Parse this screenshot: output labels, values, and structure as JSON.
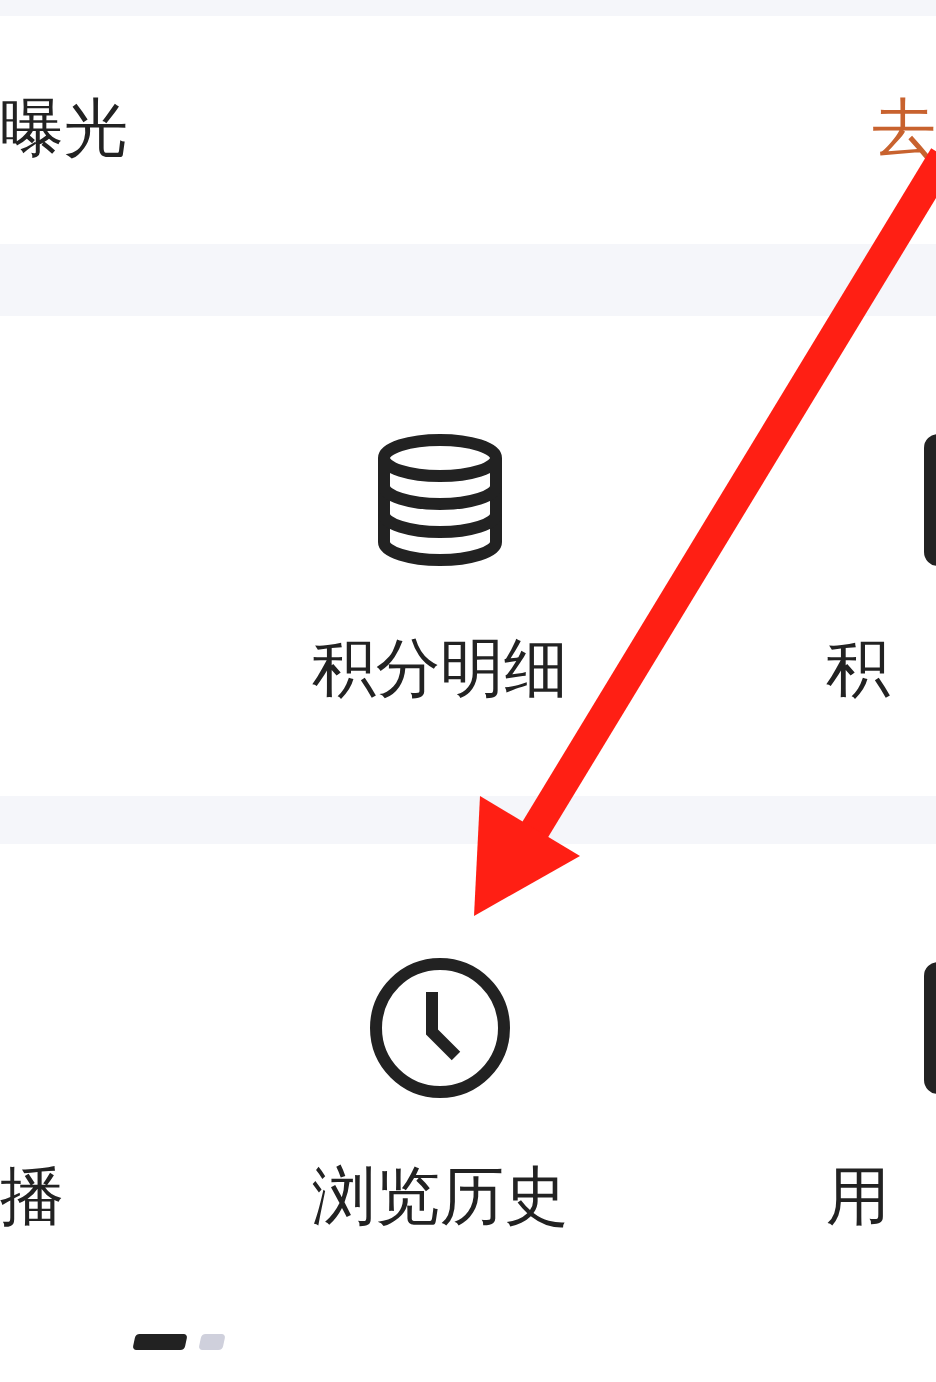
{
  "top_row": {
    "label": "曝光",
    "action": "去"
  },
  "grid_rows": [
    {
      "center": {
        "label": "积分明细"
      },
      "right": {
        "label": "积"
      }
    },
    {
      "left": {
        "label": "播"
      },
      "center": {
        "label": "浏览历史"
      },
      "right": {
        "label": "用"
      }
    }
  ],
  "pager": [
    {
      "selected": true
    },
    {
      "selected": false
    }
  ]
}
